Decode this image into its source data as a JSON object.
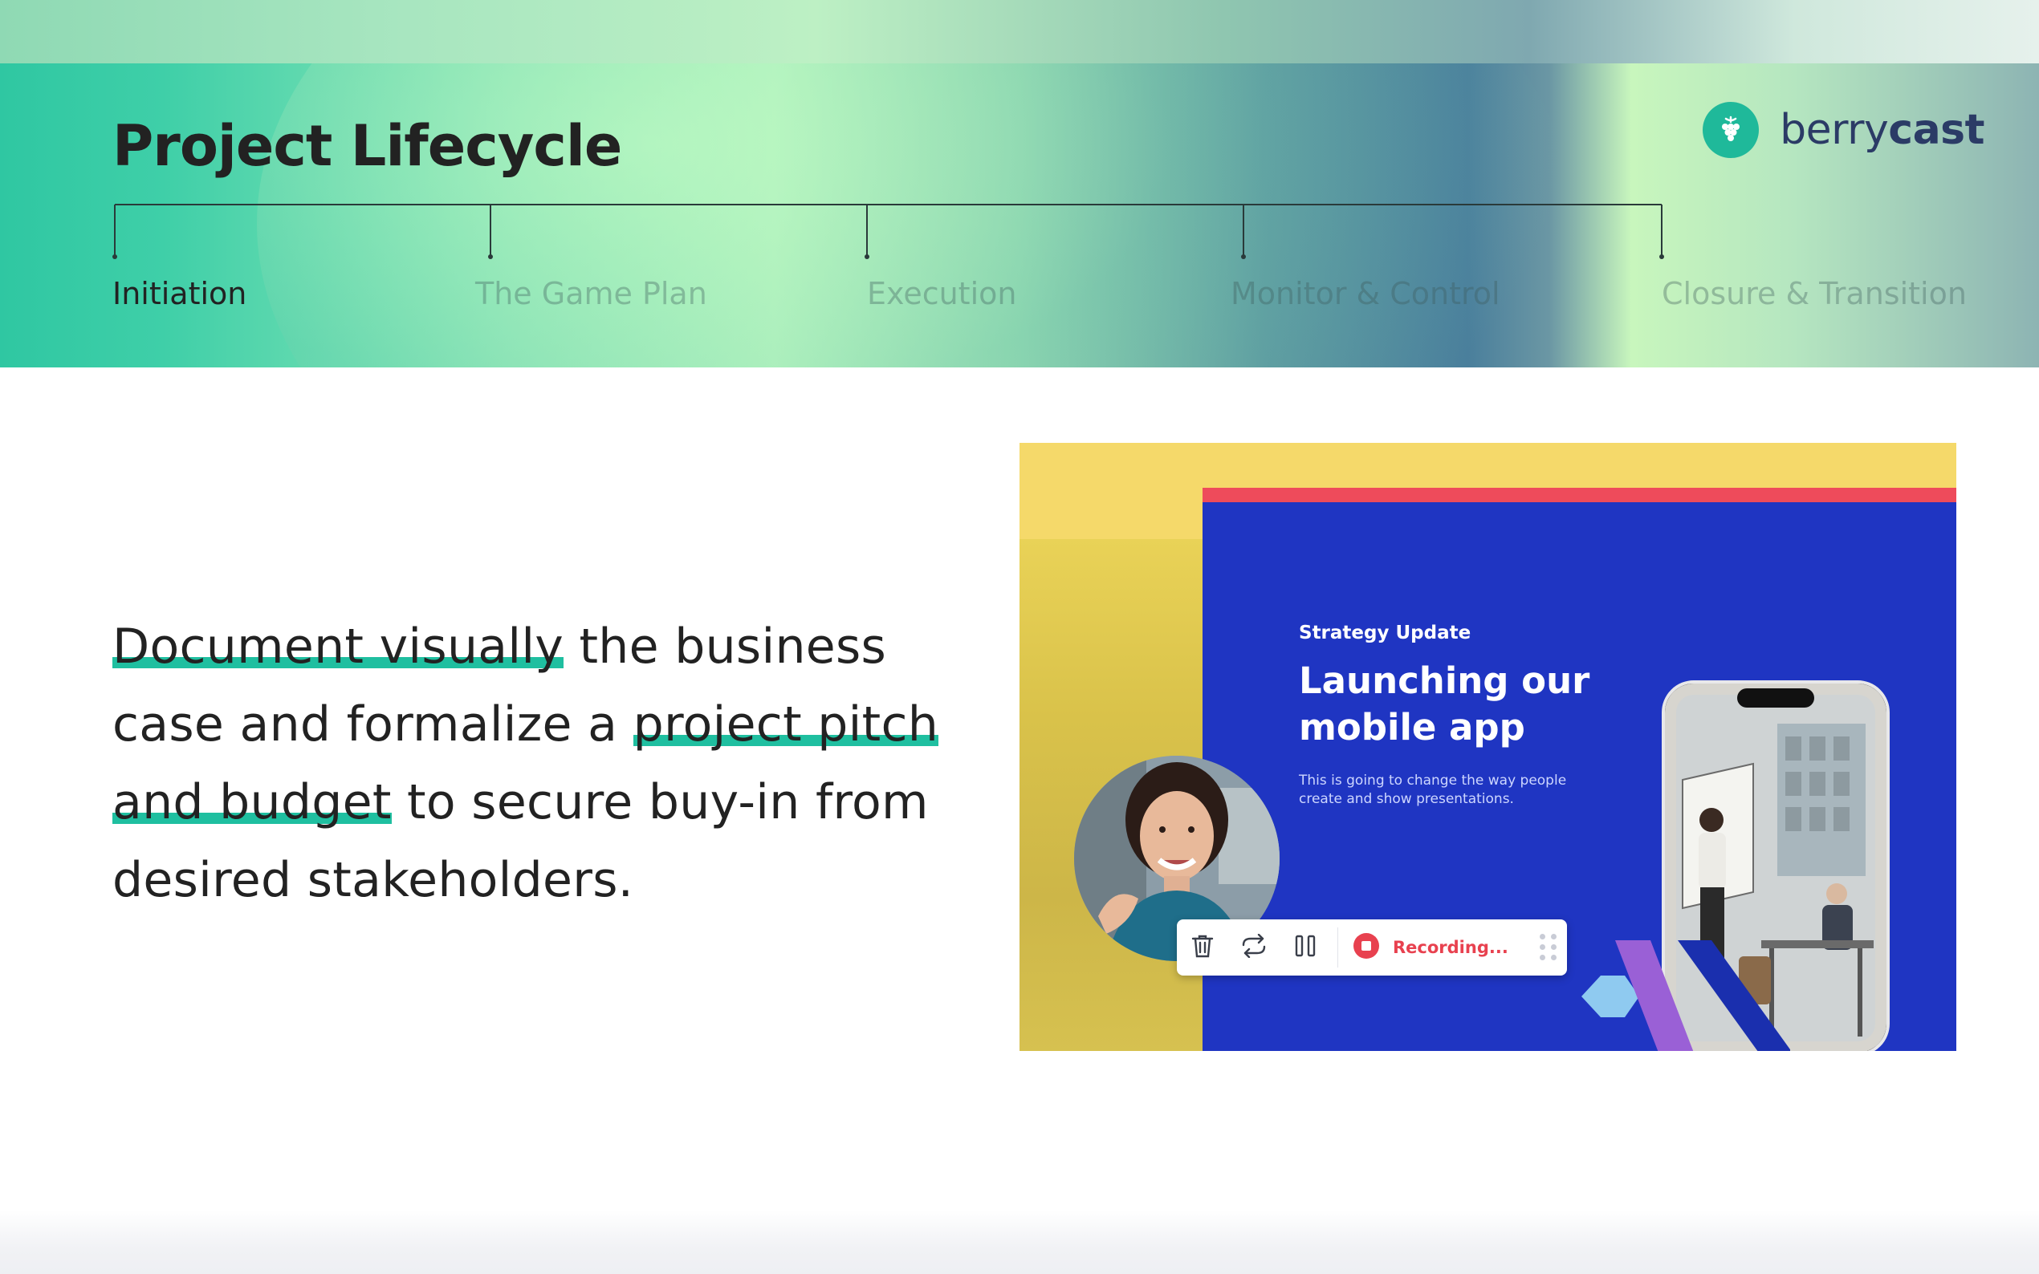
{
  "header": {
    "title": "Project Lifecycle",
    "logo": {
      "word_light": "berry",
      "word_bold": "cast",
      "icon": "berry-icon"
    }
  },
  "timeline": {
    "stages": [
      {
        "label": "Initiation",
        "active": true
      },
      {
        "label": "The Game Plan",
        "active": false
      },
      {
        "label": "Execution",
        "active": false
      },
      {
        "label": "Monitor & Control",
        "active": false
      },
      {
        "label": "Closure & Transition",
        "active": false
      }
    ]
  },
  "main": {
    "copy": {
      "highlight_1": "Document visually",
      "text_1": " the business case and formalize a ",
      "highlight_2": "project pitch and budget",
      "text_2": " to secure buy-in from desired stakeholders."
    }
  },
  "preview": {
    "slide": {
      "kicker": "Strategy Update",
      "title": "Launching our mobile app",
      "body": "This is going to change the way people create and show presentations."
    },
    "toolbar": {
      "delete_icon": "trash-icon",
      "retake_icon": "refresh-icon",
      "pause_icon": "pause-icon",
      "stop_icon": "stop-icon",
      "recording_label": "Recording...",
      "drag_icon": "drag-handle-icon"
    }
  },
  "colors": {
    "accent": "#1fbfa0",
    "text": "#222222",
    "slide_blue": "#1f35c2",
    "slide_yellow": "#f5d96a",
    "slide_red": "#ee4b5b",
    "recording_red": "#e8414f",
    "logo_navy": "#2b3b66"
  }
}
